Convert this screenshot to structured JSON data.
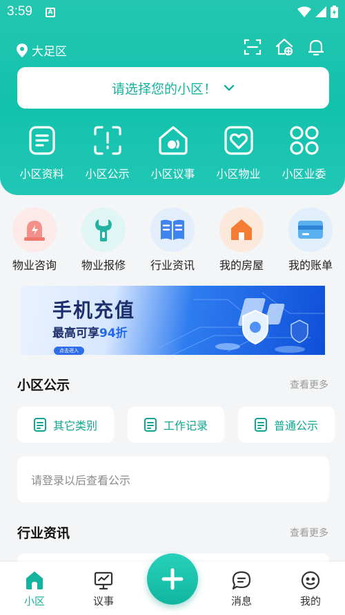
{
  "status_bar": {
    "time": "3:59",
    "app_badge": "A"
  },
  "header": {
    "location": "大足区",
    "select_placeholder": "请选择您的小区！"
  },
  "main_nav": [
    {
      "label": "小区资料",
      "icon": "document-icon"
    },
    {
      "label": "小区公示",
      "icon": "scan-notice-icon"
    },
    {
      "label": "小区议事",
      "icon": "house-chat-icon"
    },
    {
      "label": "小区物业",
      "icon": "heart-house-icon"
    },
    {
      "label": "小区业委",
      "icon": "grid-icon"
    }
  ],
  "services": [
    {
      "label": "物业咨询",
      "icon": "alarm-icon",
      "bg": "#fde9e8",
      "color": "#f0786d"
    },
    {
      "label": "物业报修",
      "icon": "wrench-icon",
      "bg": "#dff6f4",
      "color": "#21b3a2"
    },
    {
      "label": "行业资讯",
      "icon": "book-icon",
      "bg": "#e3eefc",
      "color": "#3f83f0"
    },
    {
      "label": "我的房屋",
      "icon": "home-icon",
      "bg": "#fde8dc",
      "color": "#f47c34"
    },
    {
      "label": "我的账单",
      "icon": "card-icon",
      "bg": "#e0effb",
      "color": "#4aa2e8"
    }
  ],
  "banner": {
    "title": "手机充值",
    "subtitle_prefix": "最高可享",
    "subtitle_highlight": "94折",
    "button": "点击进入"
  },
  "notice": {
    "title": "小区公示",
    "more": "查看更多",
    "chips": [
      "其它类别",
      "工作记录",
      "普通公示"
    ],
    "login_prompt": "请登录以后查看公示"
  },
  "news": {
    "title": "行业资讯",
    "more": "查看更多"
  },
  "tabbar": {
    "items": [
      "小区",
      "议事",
      "消息",
      "我的"
    ],
    "active_color": "#13b39d"
  }
}
